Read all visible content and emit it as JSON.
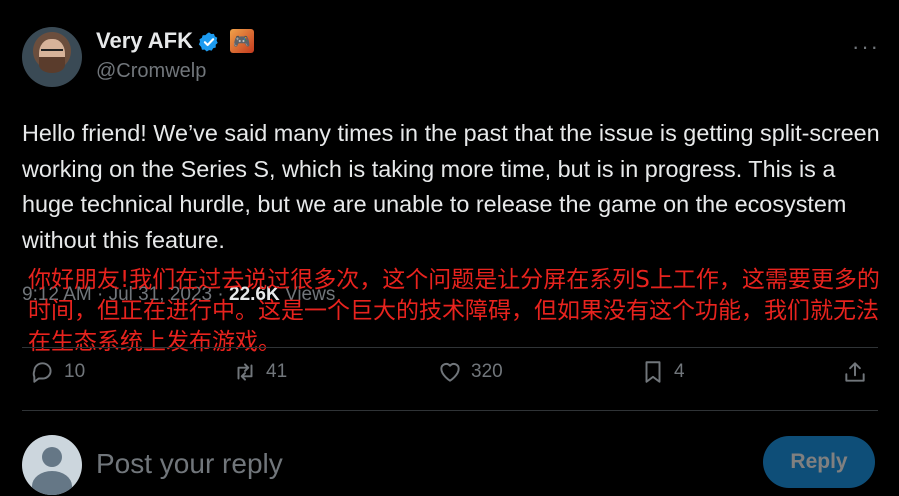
{
  "author": {
    "display_name": "Very AFK",
    "handle": "@Cromwelp",
    "badge_emoji": "🎮",
    "more_glyph": "···"
  },
  "tweet": {
    "text": "Hello friend! We’ve said many times in the past that the issue is getting split-screen working on the Series S, which is taking more time, but is in progress. This is a huge technical hurdle, but we are unable to release the game on the ecosystem without this feature.",
    "time": "9:12 AM · Jul 31, 2023 · ",
    "views_count": "22.6K",
    "views_label": " Views"
  },
  "overlay_translation": "你好朋友!我们在过去说过很多次，这个问题是让分屏在系列S上工作，这需要更多的时间，但正在进行中。这是一个巨大的技术障碍，但如果没有这个功能，我们就无法在生态系统上发布游戏。",
  "actions": {
    "replies": "10",
    "reposts": "41",
    "likes": "320",
    "bookmarks": "4"
  },
  "reply_box": {
    "placeholder": "Post your reply",
    "button_label": "Reply"
  },
  "colors": {
    "background": "#000000",
    "text": "#e7e9ea",
    "muted": "#71767b",
    "accent": "#1d9bf0",
    "overlay": "#e8231e"
  }
}
